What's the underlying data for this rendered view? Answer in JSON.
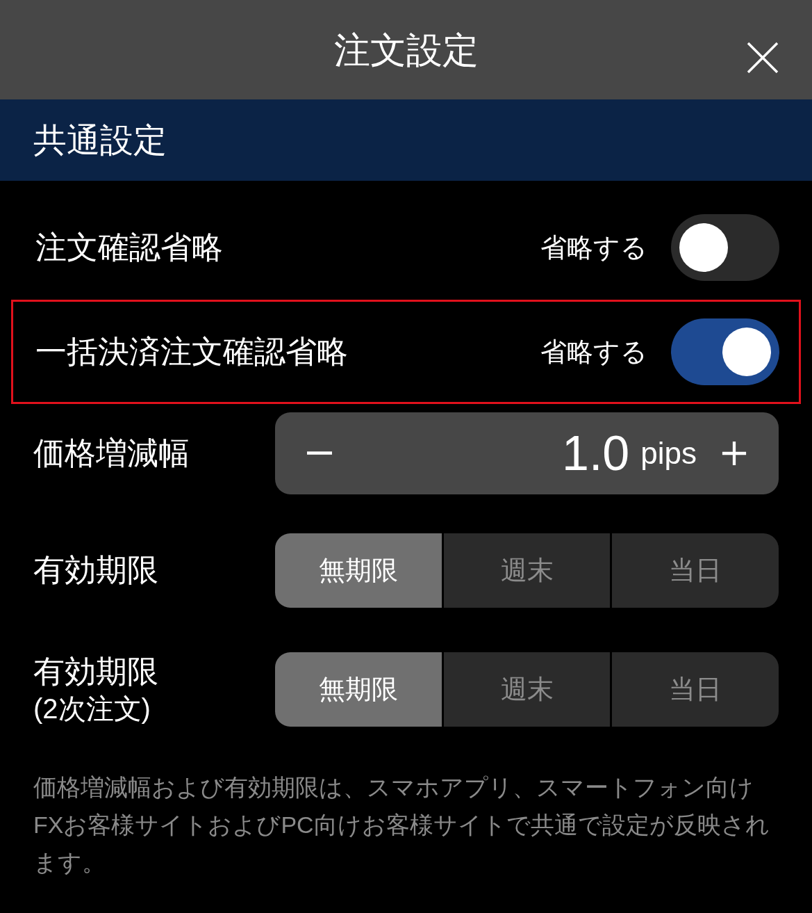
{
  "header": {
    "title": "注文設定"
  },
  "section": {
    "title": "共通設定"
  },
  "toggles": [
    {
      "label": "注文確認省略",
      "state_label": "省略する",
      "on": false,
      "highlighted": false
    },
    {
      "label": "一括決済注文確認省略",
      "state_label": "省略する",
      "on": true,
      "highlighted": true
    }
  ],
  "stepper": {
    "label": "価格増減幅",
    "value": "1.0",
    "unit": "pips"
  },
  "expiry": [
    {
      "label": "有効期限",
      "options": [
        {
          "label": "無期限",
          "selected": true
        },
        {
          "label": "週末",
          "selected": false
        },
        {
          "label": "当日",
          "selected": false
        }
      ]
    },
    {
      "label": "有効期限",
      "sublabel": "(2次注文)",
      "options": [
        {
          "label": "無期限",
          "selected": true
        },
        {
          "label": "週末",
          "selected": false
        },
        {
          "label": "当日",
          "selected": false
        }
      ]
    }
  ],
  "note": "価格増減幅および有効期限は、スマホアプリ、スマートフォン向けFXお客様サイトおよびPC向けお客様サイトで共通で設定が反映されます。"
}
